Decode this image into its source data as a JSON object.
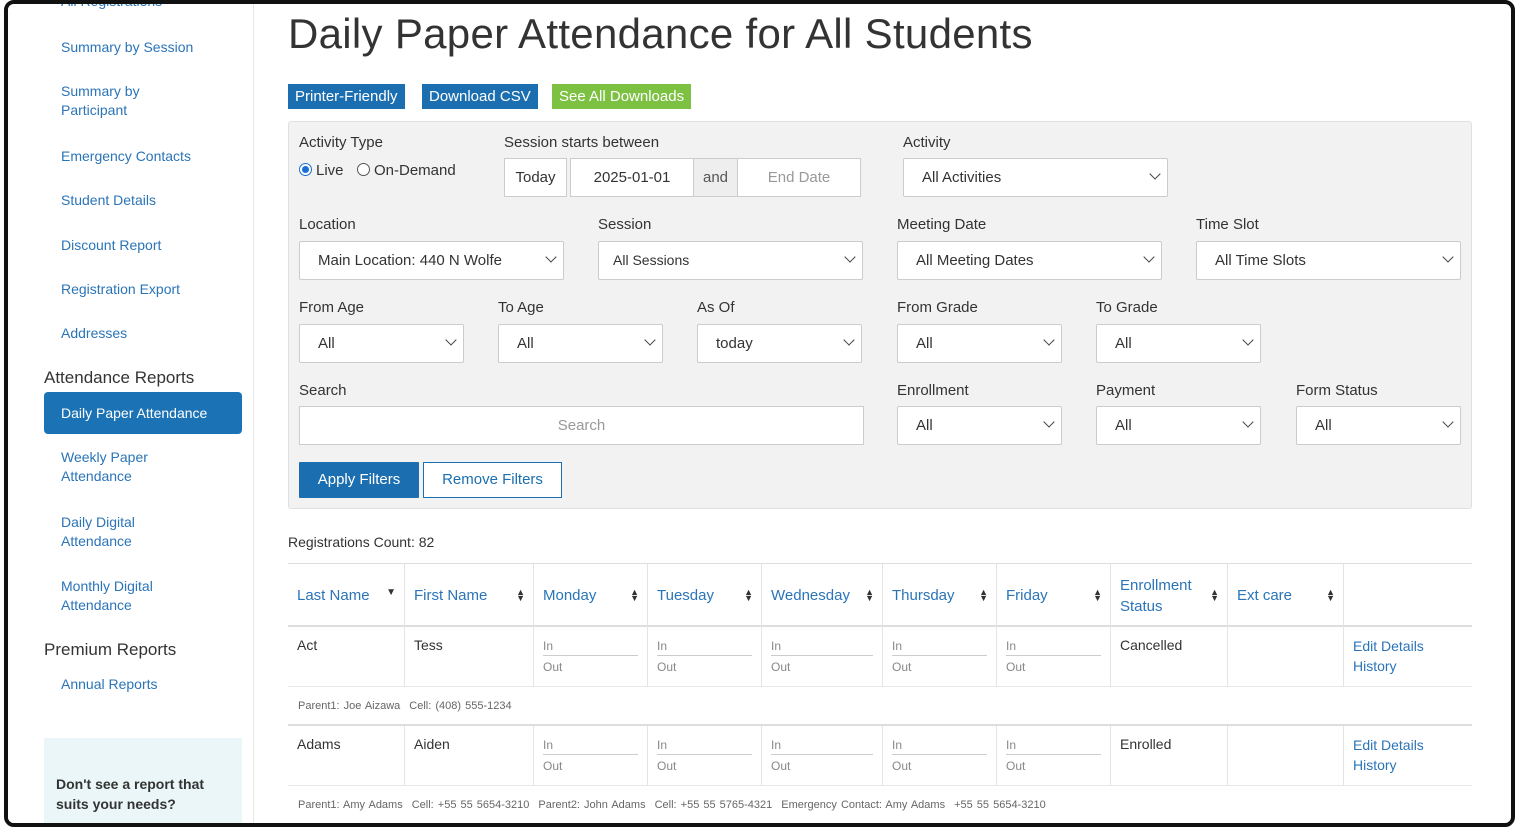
{
  "sidebar": {
    "links_top": [
      {
        "label": "All Registrations"
      },
      {
        "label": "Summary by Session"
      },
      {
        "label": "Summary by Participant"
      },
      {
        "label": "Emergency Contacts"
      },
      {
        "label": "Student Details"
      },
      {
        "label": "Discount Report"
      },
      {
        "label": "Registration Export"
      },
      {
        "label": "Addresses"
      }
    ],
    "attendance_heading": "Attendance Reports",
    "attendance_active": "Daily Paper Attendance",
    "attendance_links": [
      {
        "label": "Weekly Paper Attendance"
      },
      {
        "label": "Daily Digital Attendance"
      },
      {
        "label": "Monthly Digital Attendance"
      }
    ],
    "premium_heading": "Premium Reports",
    "premium_links": [
      {
        "label": "Annual Reports"
      }
    ],
    "help_text": "Don't see a report that suits your needs?"
  },
  "main": {
    "title": "Daily Paper Attendance for All Students",
    "buttons": {
      "printer": "Printer-Friendly",
      "csv": "Download CSV",
      "downloads": "See All Downloads"
    }
  },
  "filters": {
    "activity_type_label": "Activity Type",
    "live_label": "Live",
    "on_demand_label": "On-Demand",
    "live_selected": true,
    "session_starts_label": "Session starts between",
    "today_btn": "Today",
    "start_date": "2025-01-01",
    "and_label": "and",
    "end_date_placeholder": "End Date",
    "activity_label": "Activity",
    "activity_value": "All Activities",
    "location_label": "Location",
    "location_value": "Main Location: 440 N Wolfe",
    "session_label": "Session",
    "session_value": "All Sessions",
    "meeting_date_label": "Meeting Date",
    "meeting_date_value": "All Meeting Dates",
    "time_slot_label": "Time Slot",
    "time_slot_value": "All Time Slots",
    "from_age_label": "From Age",
    "from_age_value": "All",
    "to_age_label": "To Age",
    "to_age_value": "All",
    "as_of_label": "As Of",
    "as_of_value": "today",
    "from_grade_label": "From Grade",
    "from_grade_value": "All",
    "to_grade_label": "To Grade",
    "to_grade_value": "All",
    "search_label": "Search",
    "search_placeholder": "Search",
    "enrollment_label": "Enrollment",
    "enrollment_value": "All",
    "payment_label": "Payment",
    "payment_value": "All",
    "form_status_label": "Form Status",
    "form_status_value": "All",
    "apply": "Apply Filters",
    "remove": "Remove Filters"
  },
  "registrations_count": "Registrations Count: 82",
  "table": {
    "headers": {
      "last_name": "Last Name",
      "first_name": "First Name",
      "monday": "Monday",
      "tuesday": "Tuesday",
      "wednesday": "Wednesday",
      "thursday": "Thursday",
      "friday": "Friday",
      "enrollment_status": "Enrollment Status",
      "ext_care": "Ext care"
    },
    "in_label": "In",
    "out_label": "Out",
    "edit_details": "Edit Details",
    "history": "History",
    "rows": [
      {
        "last": "Act",
        "first": "Tess",
        "status": "Cancelled",
        "contacts": [
          "Parent1: Joe Aizawa",
          "Cell: (408) 555-1234"
        ]
      },
      {
        "last": "Adams",
        "first": "Aiden",
        "status": "Enrolled",
        "contacts": [
          "Parent1: Amy Adams",
          "Cell: +55 55 5654-3210",
          "Parent2: John Adams",
          "Cell: +55 55 5765-4321",
          "Emergency Contact: Amy Adams",
          "+55 55 5654-3210"
        ]
      }
    ]
  }
}
